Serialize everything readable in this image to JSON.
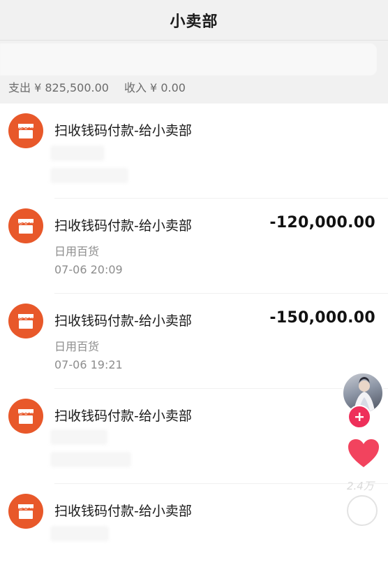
{
  "nav": {
    "title": "小卖部"
  },
  "summary": {
    "expense_label": "支出 ¥ 825,500.00",
    "income_label": "收入 ¥ 0.00"
  },
  "colors": {
    "icon_bg": "#e8582a",
    "follow_bg": "#ee2f5a",
    "like": "#f2435e"
  },
  "transactions": [
    {
      "title": "扫收钱码付款-给小卖部",
      "amount": "",
      "category": "",
      "time": "",
      "icon": "store-icon"
    },
    {
      "title": "扫收钱码付款-给小卖部",
      "amount": "-120,000.00",
      "category": "日用百货",
      "time": "07-06  20:09",
      "icon": "store-icon"
    },
    {
      "title": "扫收钱码付款-给小卖部",
      "amount": "-150,000.00",
      "category": "日用百货",
      "time": "07-06  19:21",
      "icon": "store-icon"
    },
    {
      "title": "扫收钱码付款-给小卖部",
      "amount": "",
      "category": "",
      "time": "",
      "icon": "store-icon"
    },
    {
      "title": "扫收钱码付款-给小卖部",
      "amount": "",
      "category": "",
      "time": "",
      "icon": "store-icon"
    }
  ],
  "overlay": {
    "like_count": "2.4万",
    "icons": [
      "creator-avatar",
      "follow-plus-icon",
      "heart-icon",
      "comment-icon"
    ]
  }
}
